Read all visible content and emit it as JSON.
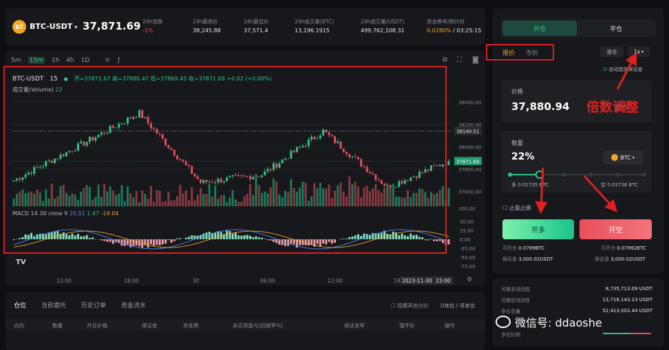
{
  "ticker": {
    "pair": "BTC-USDT",
    "price": "37,871.69",
    "logo": "BT",
    "stats": [
      {
        "label": "24h涨跌",
        "value": "-1%",
        "color": "red"
      },
      {
        "label": "24h最高价",
        "value": "38,245.88",
        "color": "normal"
      },
      {
        "label": "24h最低价",
        "value": "37,571.4",
        "color": "normal"
      },
      {
        "label": "24h成交量(BTC)",
        "value": "13,196.1915",
        "color": "normal"
      },
      {
        "label": "24h成交量(USDT)",
        "value": "499,762,108.31",
        "color": "normal"
      }
    ],
    "funding_label": "资金费率/倒计时",
    "funding_rate": "0.0280%",
    "funding_sep": " / ",
    "funding_countdown": "03:25:15"
  },
  "toolbar": {
    "timeframes": [
      "5m",
      "15m",
      "1h",
      "4h",
      "1D"
    ],
    "active": "15m"
  },
  "chart_header": {
    "pair": "BTC-USDT",
    "interval": "15",
    "ohlc": "开=37871.67 高=37886.47 低=37869.45 收=37871.69 +0.02 (+0.00%)",
    "volume_label": "成交量(Volume)",
    "volume_value": "22",
    "macd_label": "MACD 14 30 close 9",
    "macd_v1": "20.51",
    "macd_v2": "1.47",
    "macd_v3": "-19.04",
    "tv_logo": "TV"
  },
  "chart_axes": {
    "price_ticks": [
      "38400.00",
      "38200.00",
      "38000.00",
      "37800.00",
      "37600.00"
    ],
    "price_marker_hline": "38140.51",
    "price_marker_last": "37871.69",
    "volume_tick": "100.00",
    "macd_ticks": [
      "50.00",
      "25.00",
      "0.00",
      "-25.00",
      "-50.00",
      "-75.00"
    ],
    "time_ticks": [
      "12:00",
      "18:00",
      "30",
      "06:00",
      "12:00",
      "18:"
    ],
    "current_time": "2023-11-30",
    "current_time2": "23:00"
  },
  "chart_data": {
    "type": "candlestick",
    "title": "BTC-USDT 15",
    "interval": "15m",
    "ylim": [
      37480,
      38500
    ],
    "ohlc_last": {
      "open": 37871.67,
      "high": 37886.47,
      "low": 37869.45,
      "close": 37871.69
    },
    "key_points": [
      {
        "x": "start",
        "y": 37700
      },
      {
        "x": "12:00",
        "y": 37990
      },
      {
        "x": "18:00",
        "y": 38300
      },
      {
        "x": "30",
        "y": 37680
      },
      {
        "x": "06:00",
        "y": 37750
      },
      {
        "x": "12:00",
        "y": 38140
      },
      {
        "x": "18:00",
        "y": 37640
      },
      {
        "x": "end",
        "y": 37872
      }
    ],
    "volume_last": 22,
    "macd": {
      "params": "14 30 close 9",
      "macd": 20.51,
      "signal": 1.47,
      "histogram": -19.04
    }
  },
  "order": {
    "tab_open": "开仓",
    "tab_close": "平仓",
    "type_limit": "限价",
    "type_market": "市价",
    "margin_mode": "逐仓",
    "leverage": "1x",
    "auto_margin": "自动追加保证金",
    "price_label": "价格",
    "price_value": "37,880.94",
    "price_suffix": "限价",
    "qty_label": "数量",
    "qty_value": "22%",
    "qty_unit": "BTC",
    "slider_fraction": 0.22,
    "avail_long": "多 0.01735 BTC",
    "avail_short": "空 0.01736 BTC",
    "tpsl": "止盈止损",
    "btn_long": "开多",
    "btn_short": "开空",
    "left_can_open_label": "可开仓",
    "left_can_open": "0.0789BTC",
    "left_margin_label": "保证金",
    "left_margin": "3,000.02USDT",
    "right_can_open_label": "可开仓",
    "right_can_open": "0.07892BTC",
    "right_margin_label": "保证金",
    "right_margin": "3,000.02USDT"
  },
  "liquidity": {
    "rows": [
      {
        "label": "可做多流动性",
        "value": "8,735,713.09 USDT"
      },
      {
        "label": "可做空流动性",
        "value": "13,716,143.13 USDT"
      },
      {
        "label": "多仓总量",
        "value": "52,413,002.44 USDT"
      }
    ],
    "ratio_label": "多空比例"
  },
  "positions": {
    "tabs": [
      "仓位",
      "当前委托",
      "历史订单",
      "资金流水"
    ],
    "hide_other": "隐藏其他合约",
    "unit": "U本位 / 币本位",
    "columns": [
      "合约",
      "数量",
      "开仓价格",
      "保证金",
      "资金费",
      "未实现盈亏(回报率%)",
      "保证金率",
      "强平价",
      "操作"
    ]
  },
  "annotations": {
    "leverage_note": "倍数调整",
    "watermark": "微信号: ddaoshe"
  },
  "colors": {
    "up": "#2ec58a",
    "down": "#e8505b",
    "accent": "#f5a623",
    "annotation": "#e02020"
  }
}
